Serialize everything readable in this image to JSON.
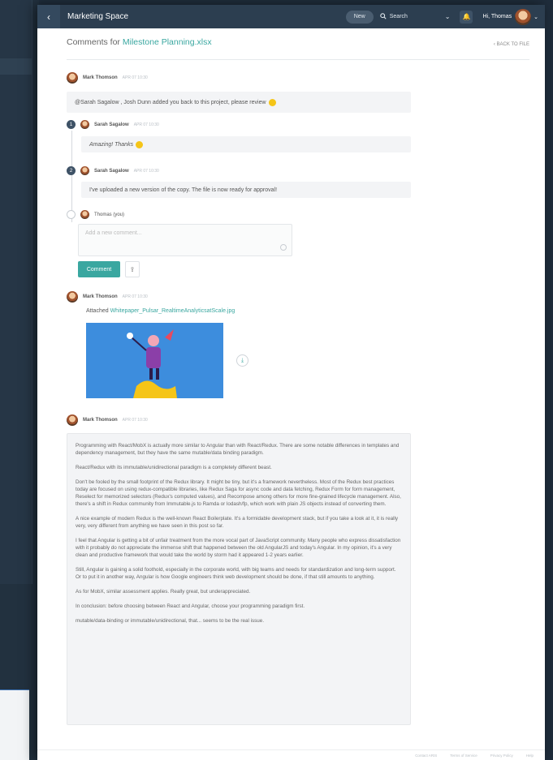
{
  "topbar": {
    "title": "Marketing Space",
    "new_label": "New",
    "search_label": "Search",
    "greeting": "Hi, Thomas"
  },
  "header": {
    "title_prefix": "Comments for ",
    "file_name": "Milestone Planning.xlsx",
    "back_label": "‹ BACK TO FILE"
  },
  "comments": [
    {
      "author": "Mark Thomson",
      "date": "APR 07 10:30",
      "text": "@Sarah Sagalow , Josh Dunn added you back to this project, please review"
    },
    {
      "number": "1",
      "author": "Sarah Sagalow",
      "date": "APR 07 10:30",
      "text": "Amazing! Thanks"
    },
    {
      "number": "2",
      "author": "Sarah Sagalow",
      "date": "APR 07 10:30",
      "text": "I've uploaded a new version of the copy. The file is now ready for approval!"
    }
  ],
  "reply": {
    "author": "Thomas (you)",
    "placeholder": "Add a new comment...",
    "comment_button": "Comment"
  },
  "attachment": {
    "author": "Mark Thomson",
    "date": "APR 07 10:30",
    "prefix": "Attached ",
    "file_name": "Whitepaper_Pulsar_RealtimeAnalyticsatScale.jpg"
  },
  "long_comment": {
    "author": "Mark Thomson",
    "date": "APR 07 10:30",
    "paragraphs": [
      "Programming with React/MobX is actually more similar to Angular than with React/Redux. There are some notable differences in templates and dependency management, but they have the same mutable/data binding paradigm.",
      "React/Redux with its immutable/unidirectional paradigm is a completely different beast.",
      "Don't be fooled by the small footprint of the Redux library. It might be tiny, but it's a framework nevertheless. Most of the Redux best practices today are focused on using redux-compatible libraries, like Redux Saga for async code and data fetching, Redux Form for form management, Reselect for memorized selectors (Redux's computed values), and Recompose among others for more fine-grained lifecycle management. Also, there's a shift in Redux community from Immutable.js to Ramda or lodash/fp, which work with plain JS objects instead of converting them.",
      "A nice example of modern Redux is the well-known React Boilerplate. It's a formidable development stack, but if you take a look at it, it is really very, very different from anything we have seen in this post so far.",
      "I feel that Angular is getting a bit of unfair treatment from the more vocal part of JavaScript community. Many people who express dissatisfaction with it probably do not appreciate the immense shift that happened between the old AngularJS and today's Angular. In my opinion, it's a very clean and productive framework that would take the world by storm had it appeared 1-2 years earlier.",
      "Still, Angular is gaining a solid foothold, especially in the corporate world, with big teams and needs for standardization and long-term support. Or to put it in another way, Angular is how Google engineers think web development should be done, if that still amounts to anything.",
      "As for MobX, similar assessment applies. Really great, but underappreciated.",
      "In conclusion: before choosing between React and Angular, choose your programming paradigm first.",
      "mutable/data-binding or immutable/unidirectional, that... seems to be the real issue."
    ]
  },
  "footer": {
    "links": [
      "Contact ARIS",
      "Terms of Service",
      "Privacy Policy",
      "Help"
    ]
  }
}
